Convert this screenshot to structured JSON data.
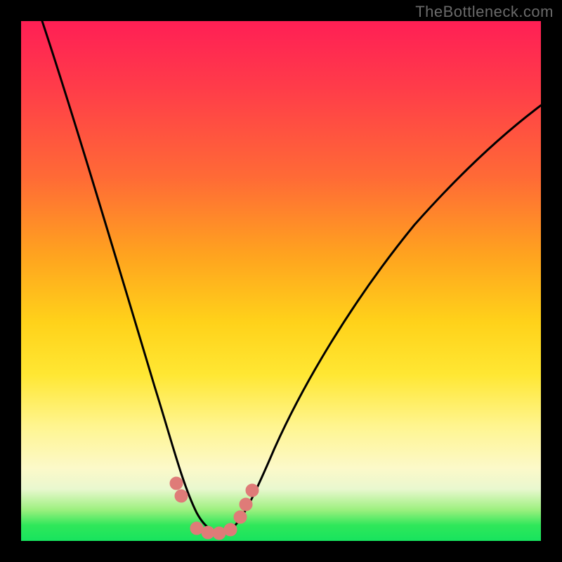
{
  "watermark": "TheBottleneck.com",
  "chart_data": {
    "type": "line",
    "title": "",
    "xlabel": "",
    "ylabel": "",
    "xlim": [
      0,
      100
    ],
    "ylim": [
      0,
      100
    ],
    "series": [
      {
        "name": "bottleneck-curve",
        "x": [
          4,
          10,
          16,
          22,
          27,
          30,
          33,
          36,
          40,
          46,
          56,
          68,
          80,
          92,
          100
        ],
        "y": [
          100,
          80,
          60,
          40,
          20,
          8,
          2,
          2,
          6,
          16,
          32,
          48,
          62,
          74,
          80
        ]
      }
    ],
    "markers": {
      "name": "highlight-beads",
      "color": "#e07a78",
      "points": [
        {
          "x": 29,
          "y": 10
        },
        {
          "x": 30,
          "y": 7
        },
        {
          "x": 32,
          "y": 2
        },
        {
          "x": 35,
          "y": 2
        },
        {
          "x": 38,
          "y": 2
        },
        {
          "x": 40,
          "y": 4
        },
        {
          "x": 41.5,
          "y": 7
        },
        {
          "x": 43,
          "y": 10
        }
      ]
    },
    "gradient_zones": [
      {
        "label": "bad-top",
        "color": "#ff1f55"
      },
      {
        "label": "mid-orange",
        "color": "#ffa31f"
      },
      {
        "label": "mid-yellow",
        "color": "#ffe733"
      },
      {
        "label": "good-green",
        "color": "#17e45e"
      }
    ]
  }
}
